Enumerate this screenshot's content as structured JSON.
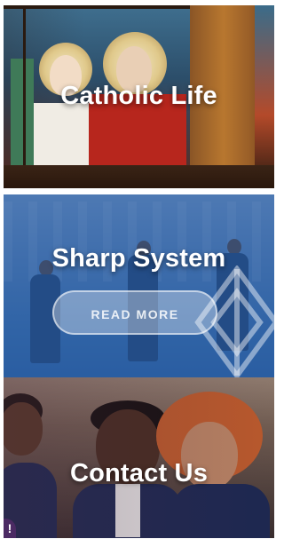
{
  "panels": {
    "catholic_life": {
      "title": "Catholic Life"
    },
    "sharp_system": {
      "title": "Sharp System",
      "button_label": "READ MORE"
    },
    "contact_us": {
      "title": "Contact Us"
    }
  },
  "alert_badge": "!",
  "colors": {
    "sharp_system_overlay": "#2f68ae",
    "button_fill": "rgba(255,255,255,0.35)",
    "alert_badge": "#4b2a63"
  }
}
